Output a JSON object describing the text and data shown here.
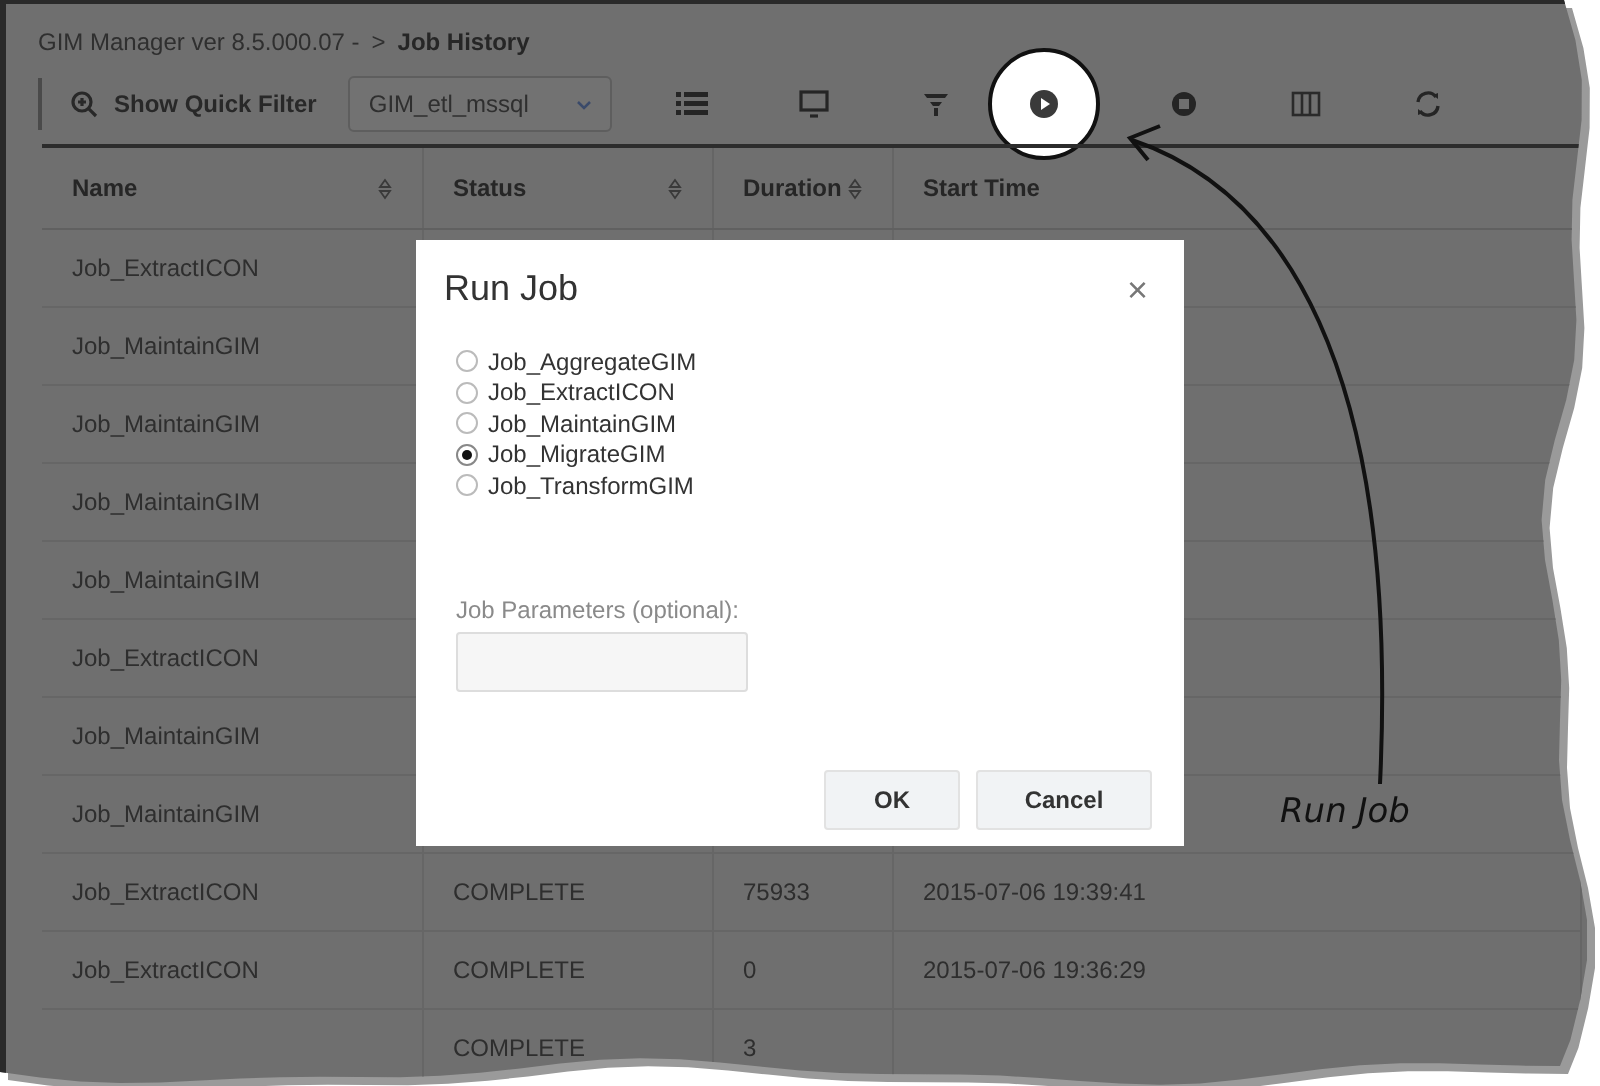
{
  "breadcrumb": {
    "path": "GIM Manager ver 8.5.000.07 -",
    "separator": ">",
    "current": "Job History"
  },
  "toolbar": {
    "quick_filter": "Show Quick Filter",
    "database": "GIM_etl_mssql"
  },
  "table": {
    "columns": [
      "Name",
      "Status",
      "Duration",
      "Start Time"
    ],
    "rows": [
      {
        "name": "Job_ExtractICON"
      },
      {
        "name": "Job_MaintainGIM"
      },
      {
        "name": "Job_MaintainGIM"
      },
      {
        "name": "Job_MaintainGIM"
      },
      {
        "name": "Job_MaintainGIM"
      },
      {
        "name": "Job_ExtractICON"
      },
      {
        "name": "Job_MaintainGIM"
      },
      {
        "name": "Job_MaintainGIM"
      },
      {
        "name": "Job_ExtractICON",
        "status": "COMPLETE",
        "duration": "75933",
        "start_time": "2015-07-06 19:39:41"
      },
      {
        "name": "Job_ExtractICON",
        "status": "COMPLETE",
        "duration": "0",
        "start_time": "2015-07-06 19:36:29"
      },
      {
        "status": "COMPLETE",
        "duration": "3"
      }
    ]
  },
  "dialog": {
    "title": "Run Job",
    "close": "×",
    "jobs": [
      {
        "label": "Job_AggregateGIM",
        "selected": false
      },
      {
        "label": "Job_ExtractICON",
        "selected": false
      },
      {
        "label": "Job_MaintainGIM",
        "selected": false
      },
      {
        "label": "Job_MigrateGIM",
        "selected": true
      },
      {
        "label": "Job_TransformGIM",
        "selected": false
      }
    ],
    "parameters_label": "Job Parameters (optional):",
    "buttons": [
      "OK",
      "Cancel"
    ]
  },
  "annotation": {
    "label": "Run Job"
  }
}
